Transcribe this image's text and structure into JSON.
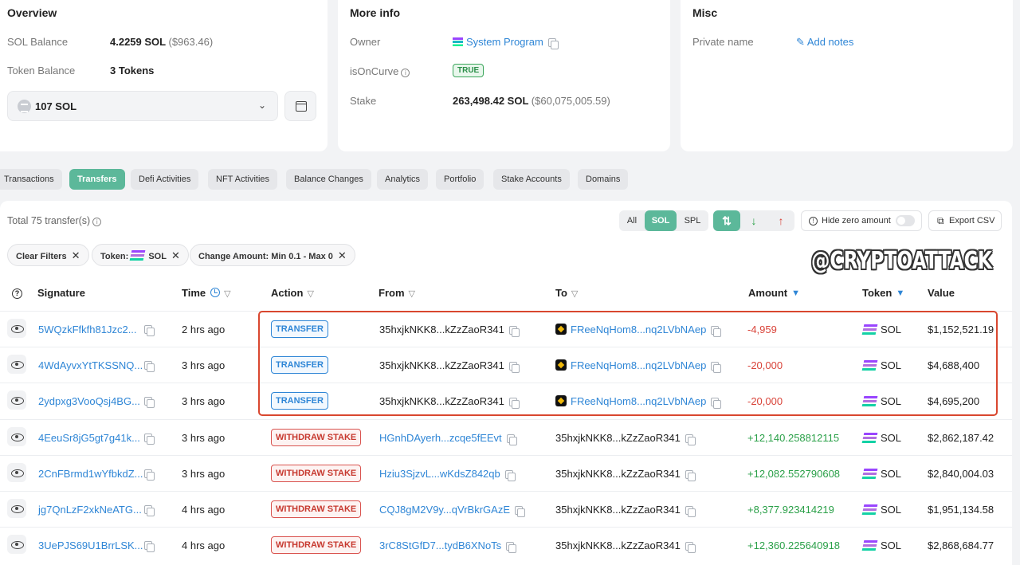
{
  "overview": {
    "title": "Overview",
    "sol_balance_label": "SOL Balance",
    "sol_balance_value": "4.2259 SOL",
    "sol_balance_usd": "($963.46)",
    "token_balance_label": "Token Balance",
    "token_balance_value": "3 Tokens",
    "select_value": "107 SOL"
  },
  "more_info": {
    "title": "More info",
    "owner_label": "Owner",
    "owner_value": "System Program",
    "is_on_curve_label": "isOnCurve",
    "is_on_curve_value": "TRUE",
    "stake_label": "Stake",
    "stake_value": "263,498.42 SOL",
    "stake_usd": "($60,075,005.59)"
  },
  "misc": {
    "title": "Misc",
    "private_name_label": "Private name",
    "add_notes": "Add notes"
  },
  "tabs": [
    "Transactions",
    "Transfers",
    "Defi Activities",
    "NFT Activities",
    "Balance Changes",
    "Analytics",
    "Portfolio",
    "Stake Accounts",
    "Domains"
  ],
  "active_tab": "Transfers",
  "toolbar": {
    "total": "Total 75 transfer(s)",
    "seg_all": "All",
    "seg_sol": "SOL",
    "seg_spl": "SPL",
    "hide_zero": "Hide zero amount",
    "export": "Export CSV"
  },
  "filters": {
    "clear": "Clear Filters",
    "token_label": "Token:",
    "token_value": "SOL",
    "change_amount": "Change Amount: Min 0.1 - Max 0"
  },
  "watermark": "@CRYPTOATTACK",
  "columns": {
    "signature": "Signature",
    "time": "Time",
    "action": "Action",
    "from": "From",
    "to": "To",
    "amount": "Amount",
    "token": "Token",
    "value": "Value"
  },
  "rows": [
    {
      "signature": "5WQzkFfkfh81Jzc2...",
      "time": "2 hrs ago",
      "action": "TRANSFER",
      "from": "35hxjkNKK8...kZzZaoR341",
      "to": "FReeNqHom8...nq2LVbNAep",
      "amount": "-4,959",
      "token": "SOL",
      "value": "$1,152,521.19"
    },
    {
      "signature": "4WdAyvxYtTKSSNQ...",
      "time": "3 hrs ago",
      "action": "TRANSFER",
      "from": "35hxjkNKK8...kZzZaoR341",
      "to": "FReeNqHom8...nq2LVbNAep",
      "amount": "-20,000",
      "token": "SOL",
      "value": "$4,688,400"
    },
    {
      "signature": "2ydpxg3VooQsj4BG...",
      "time": "3 hrs ago",
      "action": "TRANSFER",
      "from": "35hxjkNKK8...kZzZaoR341",
      "to": "FReeNqHom8...nq2LVbNAep",
      "amount": "-20,000",
      "token": "SOL",
      "value": "$4,695,200"
    },
    {
      "signature": "4EeuSr8jG5gt7g41k...",
      "time": "3 hrs ago",
      "action": "WITHDRAW STAKE",
      "from": "HGnhDAyerh...zcqe5fEEvt",
      "to": "35hxjkNKK8...kZzZaoR341",
      "amount": "+12,140.258812115",
      "token": "SOL",
      "value": "$2,862,187.42"
    },
    {
      "signature": "2CnFBrmd1wYfbkdZ...",
      "time": "3 hrs ago",
      "action": "WITHDRAW STAKE",
      "from": "Hziu3SjzvL...wKdsZ842qb",
      "to": "35hxjkNKK8...kZzZaoR341",
      "amount": "+12,082.552790608",
      "token": "SOL",
      "value": "$2,840,004.03"
    },
    {
      "signature": "jg7QnLzF2xkNeATG...",
      "time": "4 hrs ago",
      "action": "WITHDRAW STAKE",
      "from": "CQJ8gM2V9y...qVrBkrGAzE",
      "to": "35hxjkNKK8...kZzZaoR341",
      "amount": "+8,377.923414219",
      "token": "SOL",
      "value": "$1,951,134.58"
    },
    {
      "signature": "3UePJS69U1BrrLSK...",
      "time": "4 hrs ago",
      "action": "WITHDRAW STAKE",
      "from": "3rC8StGfD7...tydB6XNoTs",
      "to": "35hxjkNKK8...kZzZaoR341",
      "amount": "+12,360.225640918",
      "token": "SOL",
      "value": "$2,868,684.77"
    }
  ],
  "colors": {
    "accent": "#5cb89a",
    "link": "#2f86d6",
    "negative": "#d9443a",
    "positive": "#2aa048",
    "highlight": "#d9472f"
  }
}
